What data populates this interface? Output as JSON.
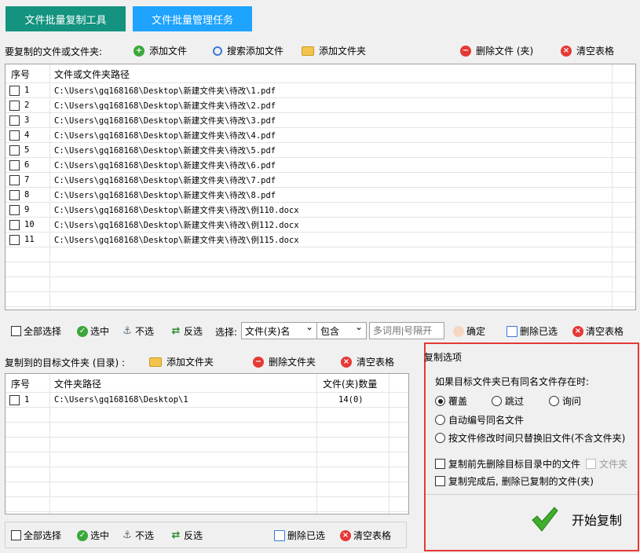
{
  "tabs": [
    "文件批量复制工具",
    "文件批量管理任务"
  ],
  "source": {
    "label": "要复制的文件或文件夹:",
    "add_file": "添加文件",
    "search_add_file": "搜索添加文件",
    "add_folder": "添加文件夹",
    "delete": "删除文件 (夹)",
    "clear": "清空表格",
    "columns": [
      "序号",
      "文件或文件夹路径"
    ],
    "rows": [
      {
        "n": "1",
        "path": "C:\\Users\\gq168168\\Desktop\\新建文件夹\\待改\\1.pdf"
      },
      {
        "n": "2",
        "path": "C:\\Users\\gq168168\\Desktop\\新建文件夹\\待改\\2.pdf"
      },
      {
        "n": "3",
        "path": "C:\\Users\\gq168168\\Desktop\\新建文件夹\\待改\\3.pdf"
      },
      {
        "n": "4",
        "path": "C:\\Users\\gq168168\\Desktop\\新建文件夹\\待改\\4.pdf"
      },
      {
        "n": "5",
        "path": "C:\\Users\\gq168168\\Desktop\\新建文件夹\\待改\\5.pdf"
      },
      {
        "n": "6",
        "path": "C:\\Users\\gq168168\\Desktop\\新建文件夹\\待改\\6.pdf"
      },
      {
        "n": "7",
        "path": "C:\\Users\\gq168168\\Desktop\\新建文件夹\\待改\\7.pdf"
      },
      {
        "n": "8",
        "path": "C:\\Users\\gq168168\\Desktop\\新建文件夹\\待改\\8.pdf"
      },
      {
        "n": "9",
        "path": "C:\\Users\\gq168168\\Desktop\\新建文件夹\\待改\\例110.docx"
      },
      {
        "n": "10",
        "path": "C:\\Users\\gq168168\\Desktop\\新建文件夹\\待改\\例112.docx"
      },
      {
        "n": "11",
        "path": "C:\\Users\\gq168168\\Desktop\\新建文件夹\\待改\\例115.docx"
      }
    ]
  },
  "select_bar": {
    "select_all": "全部选择",
    "select": "选中",
    "deselect": "不选",
    "invert": "反选",
    "choose_label": "选择:",
    "field_select": "文件(夹)名",
    "match_select": "包含",
    "keyword_placeholder": "多词用|号隔开",
    "confirm": "确定",
    "delete_selected": "删除已选",
    "clear": "清空表格"
  },
  "target": {
    "label": "复制到的目标文件夹 (目录) :",
    "add_folder": "添加文件夹",
    "delete_folder": "删除文件夹",
    "clear": "清空表格",
    "columns": [
      "序号",
      "文件夹路径",
      "文件(夹)数量"
    ],
    "rows": [
      {
        "n": "1",
        "path": "C:\\Users\\gq168168\\Desktop\\1",
        "count": "14(0)"
      }
    ]
  },
  "bottom_bar": {
    "select_all": "全部选择",
    "select": "选中",
    "deselect": "不选",
    "invert": "反选",
    "delete_selected": "删除已选",
    "clear": "清空表格"
  },
  "options": {
    "title": "复制选项",
    "conflict_label": "如果目标文件夹已有同名文件存在时:",
    "overwrite": "覆盖",
    "skip": "跳过",
    "ask": "询问",
    "auto_rename": "自动编号同名文件",
    "replace_by_time": "按文件修改时间只替换旧文件(不含文件夹)",
    "pre_delete": "复制前先删除目标目录中的文件",
    "folder_check": "文件夹",
    "post_delete": "复制完成后, 删除已复制的文件(夹)",
    "start": "开始复制"
  },
  "colors": {
    "tab_active": "#139380",
    "tab_inactive": "#1ea3ff",
    "highlight_border": "#e53935"
  }
}
